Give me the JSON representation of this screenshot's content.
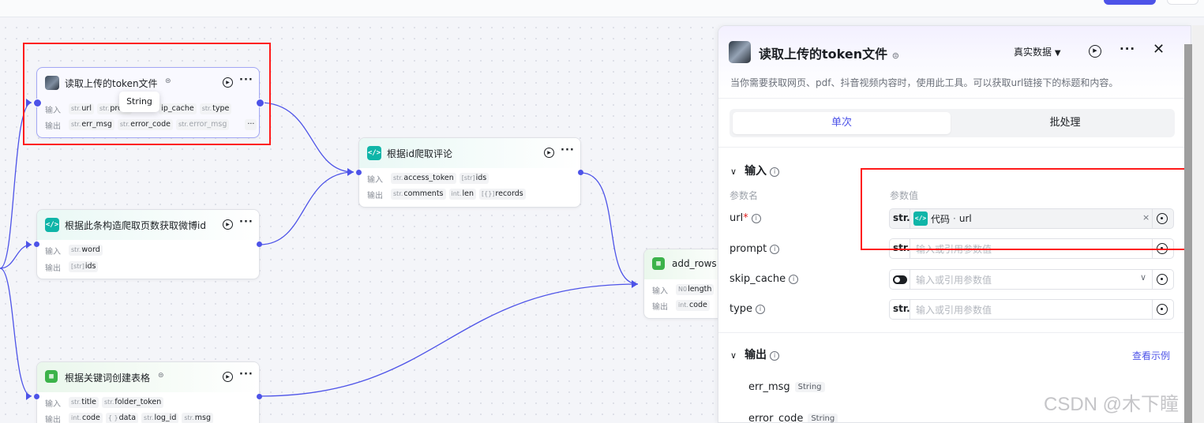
{
  "colors": {
    "accent": "#4d53e8",
    "highlight": "#ff1a1a",
    "code_icon": "#0fb5a8",
    "sheet_icon": "#3cb34a"
  },
  "canvas": {
    "tooltip": "String",
    "nodes": {
      "token_file": {
        "title": "读取上传的token文件",
        "in_label": "输入",
        "out_label": "输出",
        "inputs": [
          {
            "type": "str.",
            "name": "url"
          },
          {
            "type": "str.",
            "name": "prom"
          },
          {
            "type": "",
            "name": "ip_cache"
          },
          {
            "type": "str.",
            "name": "type"
          }
        ],
        "outputs": [
          {
            "type": "str.",
            "name": "err_msg"
          },
          {
            "type": "str.",
            "name": "error_code"
          },
          {
            "type": "str.",
            "name": "error_msg"
          }
        ],
        "more_outputs": "···"
      },
      "comments": {
        "title": "根据id爬取评论",
        "in_label": "输入",
        "out_label": "输出",
        "inputs": [
          {
            "type": "str.",
            "name": "access_token"
          },
          {
            "type": "[str]",
            "name": "ids"
          }
        ],
        "outputs": [
          {
            "type": "str.",
            "name": "comments"
          },
          {
            "type": "int.",
            "name": "len"
          },
          {
            "type": "[{}]",
            "name": "records"
          }
        ]
      },
      "weibo_id": {
        "title": "根据此条构造爬取页数获取微博id",
        "in_label": "输入",
        "out_label": "输出",
        "inputs": [
          {
            "type": "str.",
            "name": "word"
          }
        ],
        "outputs": [
          {
            "type": "[str]",
            "name": "ids"
          }
        ]
      },
      "add_rows": {
        "title": "add_rows",
        "in_label": "输入",
        "out_label": "输出",
        "inputs": [
          {
            "type": "N0",
            "name": "length"
          }
        ],
        "outputs": [
          {
            "type": "int.",
            "name": "code"
          }
        ]
      },
      "create_table": {
        "title": "根据关键词创建表格",
        "in_label": "输入",
        "out_label": "输出",
        "inputs": [
          {
            "type": "str.",
            "name": "title"
          },
          {
            "type": "str.",
            "name": "folder_token"
          }
        ],
        "outputs": [
          {
            "type": "int.",
            "name": "code"
          },
          {
            "type": "{ }",
            "name": "data"
          },
          {
            "type": "str.",
            "name": "log_id"
          },
          {
            "type": "str.",
            "name": "msg"
          }
        ]
      }
    }
  },
  "panel": {
    "title": "读取上传的token文件",
    "description": "当你需要获取网页、pdf、抖音视频内容时，使用此工具。可以获取url链接下的标题和内容。",
    "data_select": "真实数据",
    "tabs": [
      "单次",
      "批处理"
    ],
    "input_section": "输入",
    "col_name": "参数名",
    "col_value": "参数值",
    "params": [
      {
        "name": "url",
        "required": "*",
        "type": "str.",
        "ref_source": "代码",
        "ref_value": "url",
        "clear": "×"
      },
      {
        "name": "prompt",
        "type": "str.",
        "placeholder": "输入或引用参数值"
      },
      {
        "name": "skip_cache",
        "type": "toggle",
        "placeholder": "输入或引用参数值"
      },
      {
        "name": "type",
        "type": "str.",
        "placeholder": "输入或引用参数值"
      }
    ],
    "output_section": "输出",
    "example_link": "查看示例",
    "outputs": [
      {
        "name": "err_msg",
        "type": "String"
      },
      {
        "name": "error_code",
        "type": "String"
      }
    ]
  },
  "watermark": "CSDN @木下瞳"
}
